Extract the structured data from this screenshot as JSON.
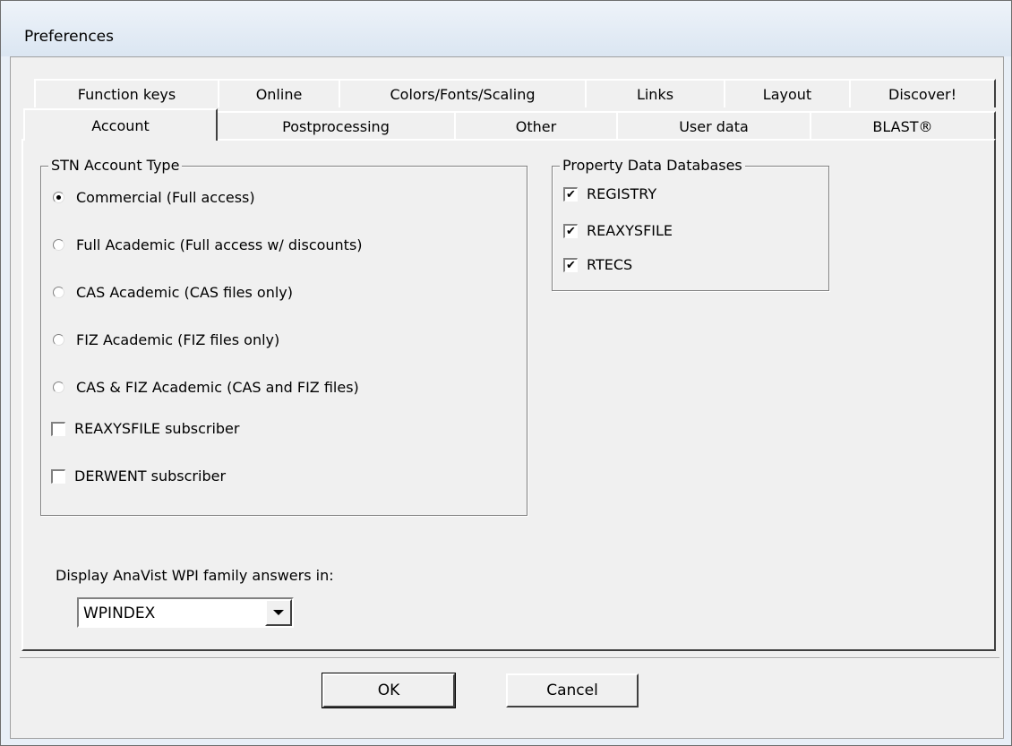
{
  "window": {
    "title": "Preferences"
  },
  "tabs_row1": [
    "Function keys",
    "Online",
    "Colors/Fonts/Scaling",
    "Links",
    "Layout",
    "Discover!"
  ],
  "tabs_row2": [
    "Account",
    "Postprocessing",
    "Other",
    "User data",
    "BLAST®"
  ],
  "selected_tab": "Account",
  "account_group": {
    "legend": "STN Account Type",
    "options": [
      "Commercial (Full access)",
      "Full Academic (Full access w/ discounts)",
      "CAS Academic (CAS files only)",
      "FIZ Academic (FIZ files only)",
      "CAS & FIZ Academic (CAS and FIZ files)"
    ],
    "selected_index": 0,
    "checkboxes": [
      {
        "label": "REAXYSFILE subscriber",
        "checked": false
      },
      {
        "label": "DERWENT subscriber",
        "checked": false
      }
    ]
  },
  "property_group": {
    "legend": "Property Data Databases",
    "items": [
      {
        "label": "REGISTRY",
        "checked": true
      },
      {
        "label": "REAXYSFILE",
        "checked": true
      },
      {
        "label": "RTECS",
        "checked": true
      }
    ]
  },
  "display": {
    "label": "Display AnaVist WPI family answers in:",
    "selected": "WPINDEX"
  },
  "buttons": {
    "ok": "OK",
    "cancel": "Cancel"
  },
  "check_mark": "✔"
}
